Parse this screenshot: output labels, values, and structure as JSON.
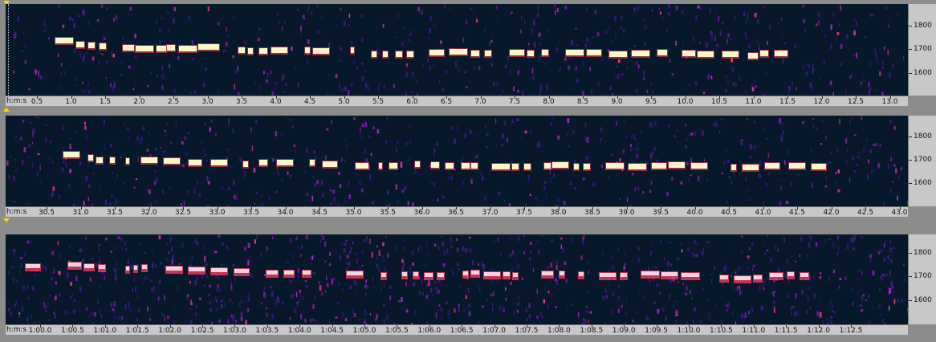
{
  "app": {
    "view": "spectrogram-stack"
  },
  "colors": {
    "background": "#07182b",
    "call": "#fff6c8",
    "call_edge": "#ff4060",
    "noise": "#a020c0"
  },
  "panels": [
    {
      "time_unit": "h:m:s",
      "freq_labels": [
        "1800",
        "1700",
        "1600"
      ],
      "time_labels": [
        "0.5",
        "1.0",
        "1.5",
        "2.0",
        "2.5",
        "3.0",
        "3.5",
        "4.0",
        "4.5",
        "5.0",
        "5.5",
        "6.0",
        "6.5",
        "7.0",
        "7.5",
        "8.0",
        "8.5",
        "9.0",
        "9.5",
        "10.0",
        "10.5",
        "11.0",
        "11.5",
        "12.0",
        "12.5",
        "13.0"
      ]
    },
    {
      "time_unit": "h:m:s",
      "freq_labels": [
        "1800",
        "1700",
        "1600"
      ],
      "time_labels": [
        "30.5",
        "31.0",
        "31.5",
        "32.0",
        "32.5",
        "33.0",
        "33.5",
        "34.0",
        "34.5",
        "35.0",
        "35.5",
        "36.0",
        "36.5",
        "37.0",
        "37.5",
        "38.0",
        "38.5",
        "39.0",
        "39.5",
        "40.0",
        "40.5",
        "41.0",
        "41.5",
        "42.0",
        "42.5",
        "43.0"
      ]
    },
    {
      "time_unit": "h:m:s",
      "freq_labels": [
        "1800",
        "1700",
        "1600"
      ],
      "time_labels": [
        "1:00.0",
        "1:00.5",
        "1:01.0",
        "1:01.5",
        "1:02.0",
        "1:02.5",
        "1:03.0",
        "1:03.5",
        "1:04.0",
        "1:04.5",
        "1:05.0",
        "1:05.5",
        "1:06.0",
        "1:06.5",
        "1:07.0",
        "1:07.5",
        "1:08.0",
        "1:08.5",
        "1:09.0",
        "1:09.5",
        "1:10.0",
        "1:10.5",
        "1:11.0",
        "1:11.5",
        "1:12.0",
        "1:12.5"
      ]
    }
  ]
}
